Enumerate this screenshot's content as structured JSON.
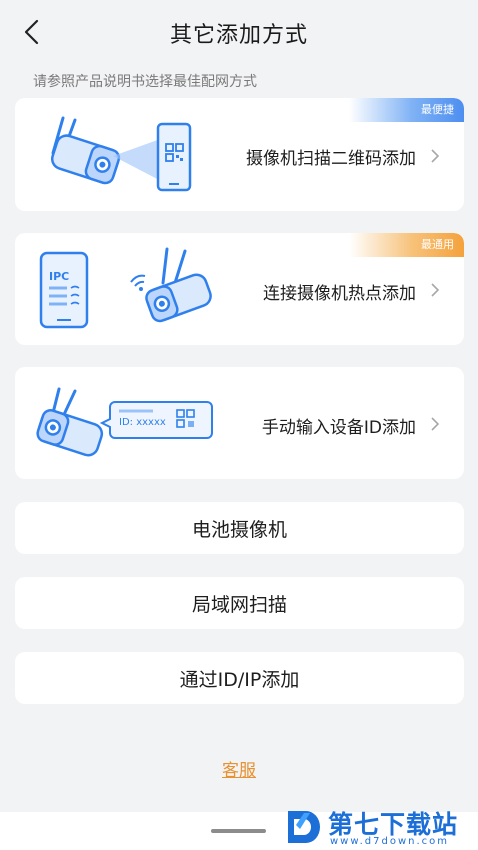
{
  "header": {
    "title": "其它添加方式"
  },
  "subtitle": "请参照产品说明书选择最佳配网方式",
  "options": [
    {
      "label": "摄像机扫描二维码添加",
      "badge": "最便捷"
    },
    {
      "label": "连接摄像机热点添加",
      "badge": "最通用",
      "phone_text": "IPC"
    },
    {
      "label": "手动输入设备ID添加",
      "id_text": "ID: xxxxx"
    }
  ],
  "simple_options": [
    "电池摄像机",
    "局域网扫描",
    "通过ID/IP添加"
  ],
  "service_label": "客服",
  "watermark": {
    "main": "第七下载站",
    "sub": "www.d7down.com"
  },
  "colors": {
    "accent_blue": "#4d8ef0",
    "accent_orange": "#f4a23c",
    "link_orange": "#e8912f",
    "background": "#f2f3f5"
  }
}
